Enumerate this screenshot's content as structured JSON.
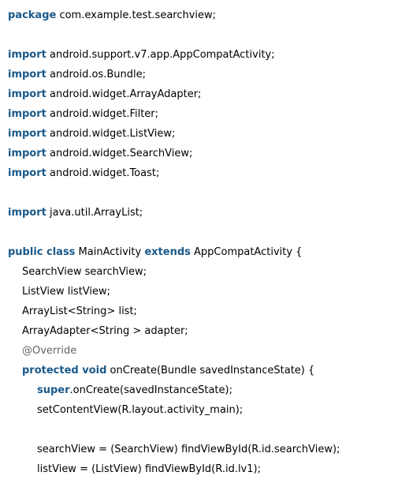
{
  "code": {
    "lines": [
      {
        "kw": "package",
        "text": " com.example.test.searchview;"
      },
      {},
      {
        "kw": "import",
        "text": " android.support.v7.app.AppCompatActivity;"
      },
      {
        "kw": "import",
        "text": " android.os.Bundle;"
      },
      {
        "kw": "import",
        "text": " android.widget.ArrayAdapter;"
      },
      {
        "kw": "import",
        "text": " android.widget.Filter;"
      },
      {
        "kw": "import",
        "text": " android.widget.ListView;"
      },
      {
        "kw": "import",
        "text": " android.widget.SearchView;"
      },
      {
        "kw": "import",
        "text": " android.widget.Toast;"
      },
      {},
      {
        "kw": "import",
        "text": " java.util.ArrayList;"
      },
      {},
      {
        "kw1": "public class",
        "text1": " MainActivity ",
        "kw2": "extends",
        "text2": " AppCompatActivity {"
      },
      {
        "text": "SearchView searchView;"
      },
      {
        "text": "ListView listView;"
      },
      {
        "text": "ArrayList<String> list;"
      },
      {
        "text": "ArrayAdapter<String > adapter;"
      },
      {
        "annotation": "@Override"
      },
      {
        "kw": "protected void",
        "text": " onCreate(Bundle savedInstanceState) {"
      },
      {
        "kw": "super",
        "text": ".onCreate(savedInstanceState);"
      },
      {
        "text": "setContentView(R.layout.activity_main);"
      },
      {},
      {
        "text": "searchView = (SearchView) findViewById(R.id.searchView);"
      },
      {
        "text": "listView = (ListView) findViewById(R.id.lv1);"
      }
    ]
  }
}
